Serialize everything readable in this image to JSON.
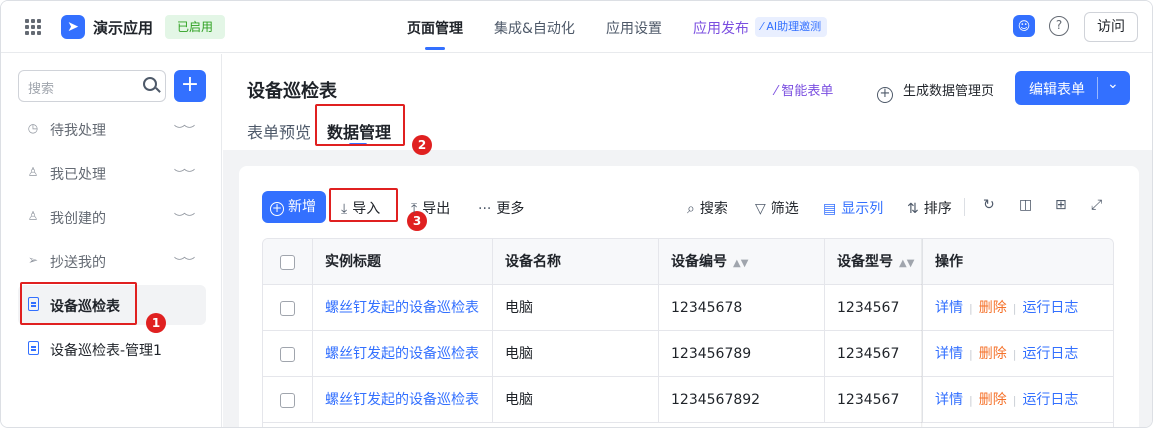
{
  "header": {
    "app_name": "演示应用",
    "status_badge": "已启用",
    "nav": [
      "页面管理",
      "集成&自动化",
      "应用设置"
    ],
    "publish": "应用发布",
    "ai_chip": "AI助理邀测",
    "visit_button": "访问"
  },
  "sidebar": {
    "search_placeholder": "搜索",
    "add_label": "+",
    "items": [
      {
        "label": "待我处理"
      },
      {
        "label": "我已处理"
      },
      {
        "label": "我创建的"
      },
      {
        "label": "抄送我的"
      },
      {
        "label": "设备巡检表"
      },
      {
        "label": "设备巡检表-管理1"
      }
    ]
  },
  "page": {
    "title": "设备巡检表",
    "smart_form": "智能表单",
    "gen_page": "生成数据管理页",
    "edit_button": "编辑表单",
    "tabs": [
      "表单预览",
      "数据管理"
    ]
  },
  "toolbar": {
    "new": "新增",
    "import": "导入",
    "export": "导出",
    "more": "更多",
    "search": "搜索",
    "filter": "筛选",
    "columns": "显示列",
    "sort": "排序"
  },
  "table": {
    "columns": [
      "实例标题",
      "设备名称",
      "设备编号",
      "设备型号",
      "操作"
    ],
    "rows": [
      {
        "title": "螺丝钉发起的设备巡检表",
        "name": "电脑",
        "code": "12345678",
        "model": "1234567"
      },
      {
        "title": "螺丝钉发起的设备巡检表",
        "name": "电脑",
        "code": "123456789",
        "model": "1234567"
      },
      {
        "title": "螺丝钉发起的设备巡检表",
        "name": "电脑",
        "code": "1234567892",
        "model": "1234567"
      }
    ],
    "actions": {
      "detail": "详情",
      "delete": "删除",
      "log": "运行日志"
    }
  },
  "annotations": [
    "1",
    "2",
    "3"
  ],
  "colors": {
    "accent": "#3370ff",
    "highlight": "#e02020",
    "danger": "#f5722b"
  }
}
